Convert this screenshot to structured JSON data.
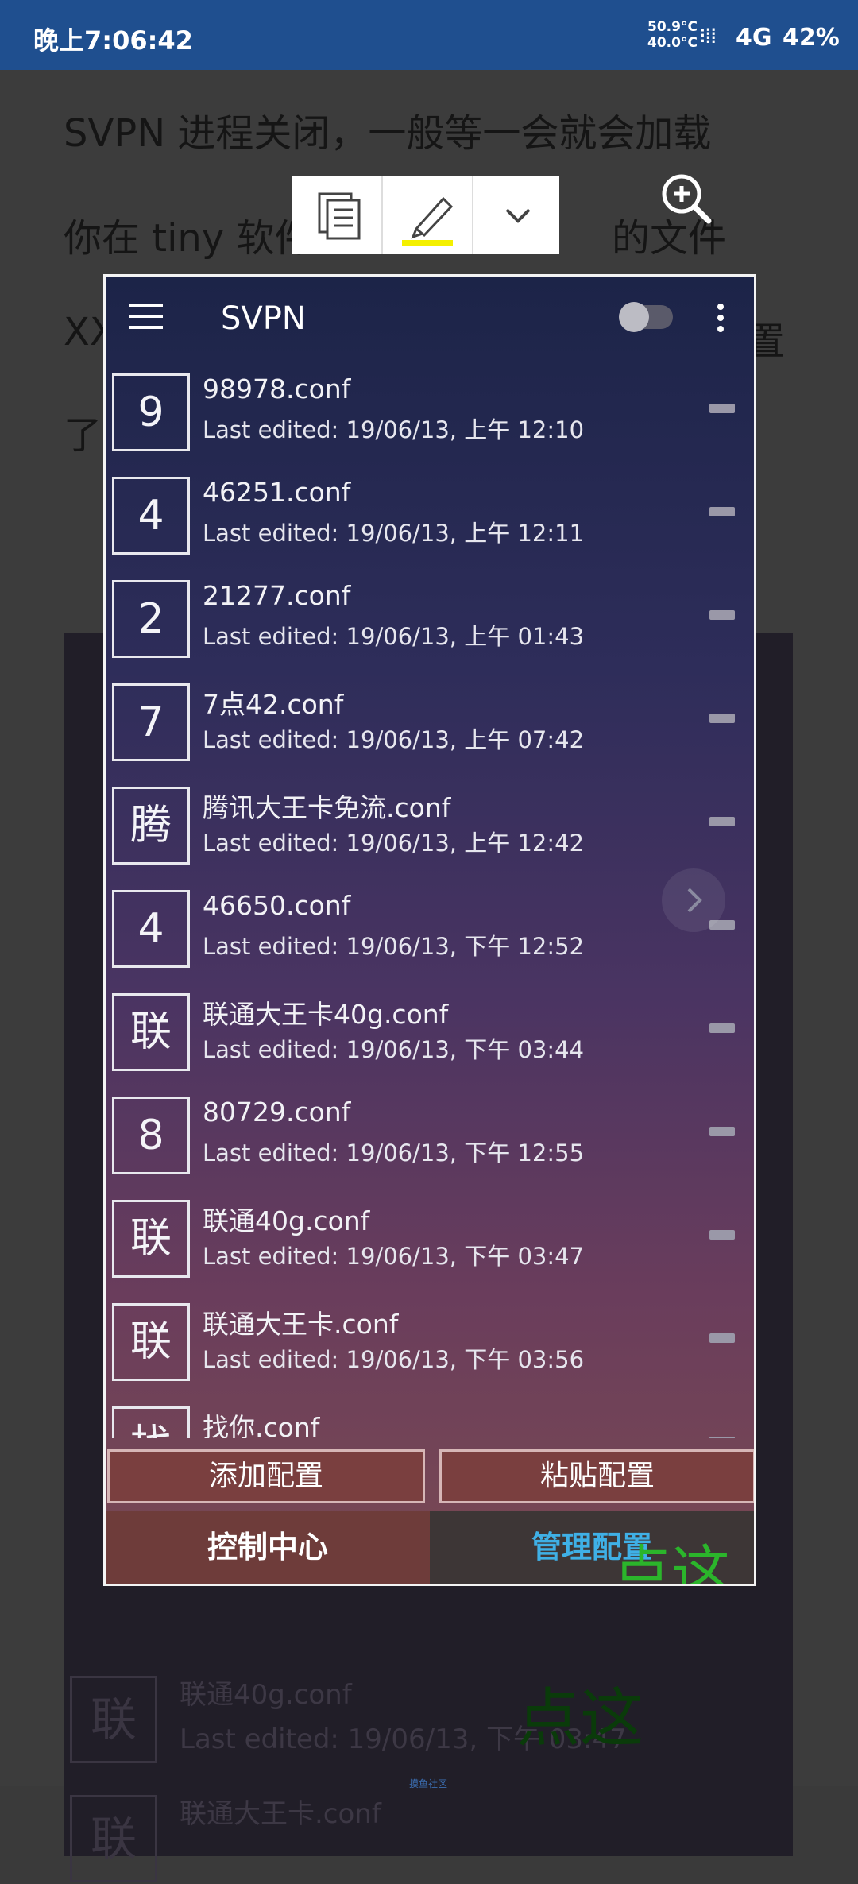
{
  "status_bar": {
    "time": "晚上7:06:42",
    "temp_top": "50.9°C",
    "temp_bottom": "40.0°C",
    "network": "4G",
    "battery": "42%"
  },
  "article": {
    "lines": [
      "SVPN 进程关闭，一般等一会就会加载",
      "你在 tiny 软件",
      "的文件",
      "XX",
      "置",
      "了"
    ]
  },
  "toolbar": {
    "copy_icon": "copy-icon",
    "highlight_icon": "highlighter-icon",
    "more_icon": "chevron-down-icon",
    "zoom_icon": "zoom-in-icon"
  },
  "app": {
    "title": "SVPN",
    "items": [
      {
        "badge": "9",
        "name": "98978.conf",
        "edited": "Last edited: 19/06/13, 上午 12:10"
      },
      {
        "badge": "4",
        "name": "46251.conf",
        "edited": "Last edited: 19/06/13, 上午 12:11"
      },
      {
        "badge": "2",
        "name": "21277.conf",
        "edited": "Last edited: 19/06/13, 上午 01:43"
      },
      {
        "badge": "7",
        "name": "7点42.conf",
        "edited": "Last edited: 19/06/13, 上午 07:42"
      },
      {
        "badge": "腾",
        "name": "腾讯大王卡免流.conf",
        "edited": "Last edited: 19/06/13, 上午 12:42"
      },
      {
        "badge": "4",
        "name": "46650.conf",
        "edited": "Last edited: 19/06/13, 下午 12:52"
      },
      {
        "badge": "联",
        "name": "联通大王卡40g.conf",
        "edited": "Last edited: 19/06/13, 下午 03:44"
      },
      {
        "badge": "8",
        "name": "80729.conf",
        "edited": "Last edited: 19/06/13, 下午 12:55"
      },
      {
        "badge": "联",
        "name": "联通40g.conf",
        "edited": "Last edited: 19/06/13, 下午 03:47"
      },
      {
        "badge": "联",
        "name": "联通大王卡.conf",
        "edited": "Last edited: 19/06/13, 下午 03:56"
      },
      {
        "badge": "找",
        "name": "找你.conf",
        "edited": ""
      }
    ],
    "add_config": "添加配置",
    "paste_config": "粘贴配置",
    "tab_control": "控制中心",
    "tab_manage": "管理配置"
  },
  "annotation": {
    "text": "点这",
    "color": "#2bb52b",
    "arrow_color": "#e8201a"
  },
  "background": {
    "items": [
      {
        "badge": "联",
        "name": "联通40g.conf",
        "edited": "Last edited: 19/06/13, 下午 03:47"
      },
      {
        "badge": "联",
        "name": "联通大王卡.conf",
        "edited": ""
      }
    ],
    "annotation": "点这",
    "footer": "摸鱼社区"
  }
}
